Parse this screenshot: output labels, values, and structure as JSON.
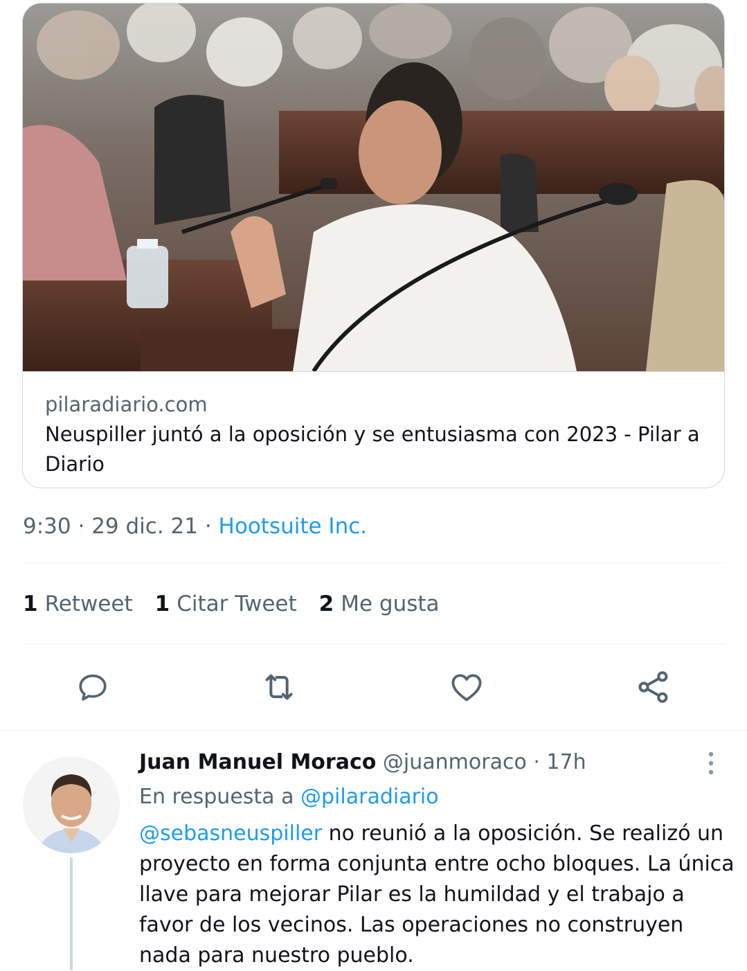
{
  "card": {
    "image_alt": "Photo: man in white shirt speaking into a microphone in a council chamber",
    "domain": "pilaradiario.com",
    "title": "Neuspiller juntó a la oposición y se entusiasma con 2023 - Pilar a Diario"
  },
  "tweet": {
    "time": "9:30",
    "date": "29 dic. 21",
    "separator": " · ",
    "source": "Hootsuite Inc."
  },
  "stats": [
    {
      "count": "1",
      "label": "Retweet"
    },
    {
      "count": "1",
      "label": "Citar Tweet"
    },
    {
      "count": "2",
      "label": "Me gusta"
    }
  ],
  "actions": [
    {
      "icon": "reply-icon"
    },
    {
      "icon": "retweet-icon"
    },
    {
      "icon": "like-icon"
    },
    {
      "icon": "share-icon"
    }
  ],
  "reply": {
    "name": "Juan Manuel Moraco",
    "handle": "@juanmoraco",
    "dot": " · ",
    "time": "17h",
    "in_reply_prefix": "En respuesta a ",
    "in_reply_handle": "@pilaradiario",
    "mention": "@sebasneuspiller",
    "text": " no reunió a la oposición. Se realizó un proyecto en forma conjunta entre ocho bloques. La única llave para mejorar Pilar es la humildad y el trabajo a favor de los vecinos. Las operaciones no construyen nada para nuestro pueblo."
  },
  "colors": {
    "link_blue": "#1d9bf0",
    "secondary_text": "#536471",
    "primary_text": "#0f1419",
    "border": "#cfd9de"
  }
}
